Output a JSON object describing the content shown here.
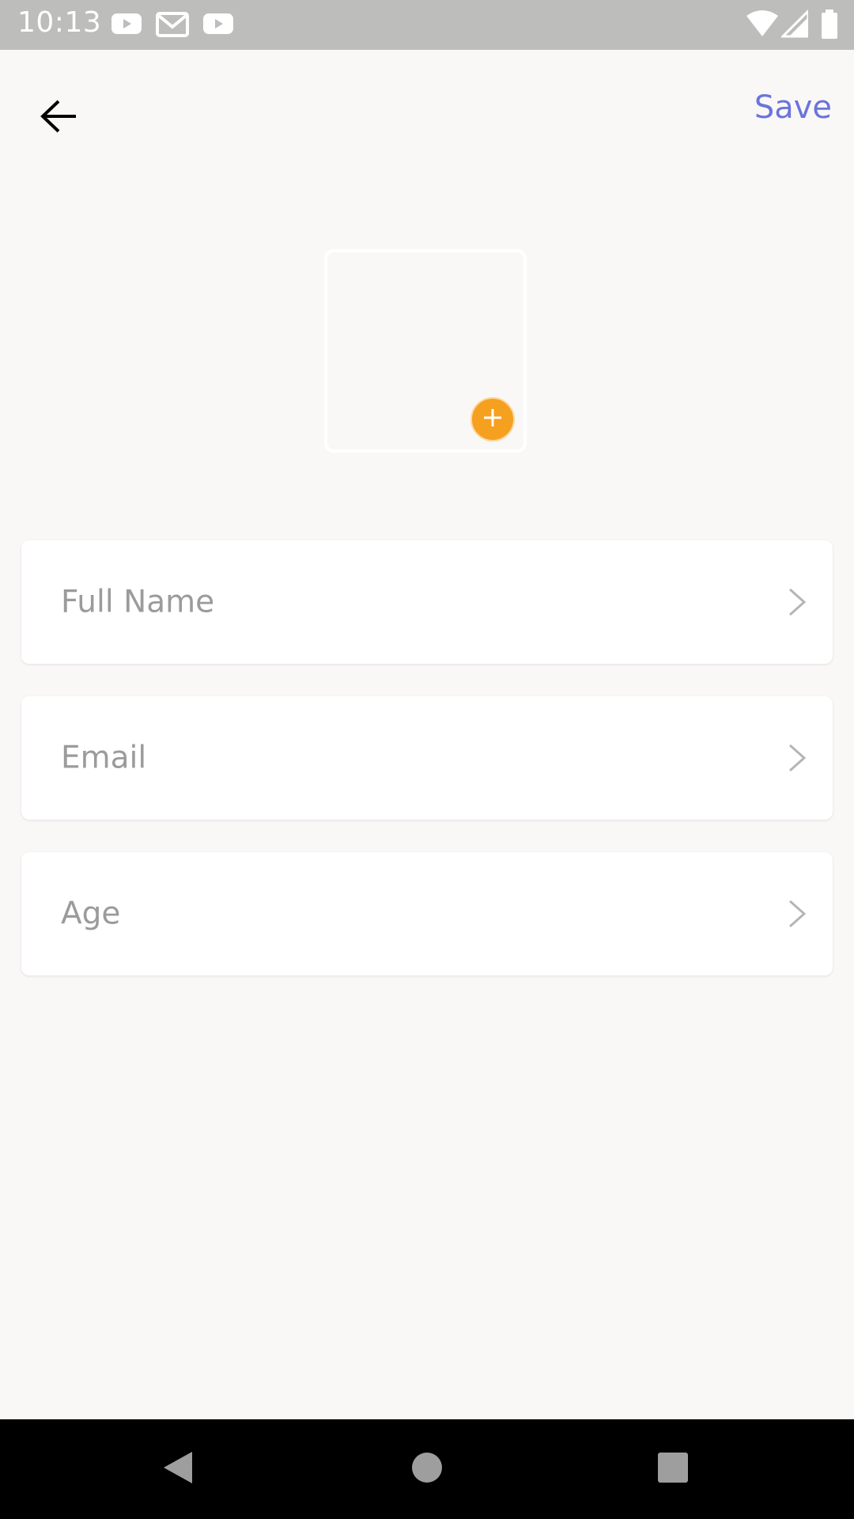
{
  "status_bar": {
    "time": "10:13",
    "notification_icons": [
      "youtube-icon",
      "gmail-icon",
      "youtube-icon"
    ],
    "system_icons": [
      "wifi-icon",
      "cell-signal-icon",
      "battery-icon"
    ]
  },
  "app_bar": {
    "back_icon": "arrow-left-icon",
    "save_label": "Save"
  },
  "photo": {
    "add_icon": "plus-icon",
    "accent_color": "#f6a020"
  },
  "fields": [
    {
      "label": "Full Name",
      "icon": "chevron-right-icon"
    },
    {
      "label": "Email",
      "icon": "chevron-right-icon"
    },
    {
      "label": "Age",
      "icon": "chevron-right-icon"
    }
  ],
  "nav_bar": {
    "buttons": [
      "back-triangle-icon",
      "home-circle-icon",
      "recents-square-icon"
    ]
  },
  "colors": {
    "background": "#f9f8f7",
    "status_bar": "#bdbdbc",
    "save_text": "#6b74dc",
    "field_text": "#9b9b9b"
  }
}
